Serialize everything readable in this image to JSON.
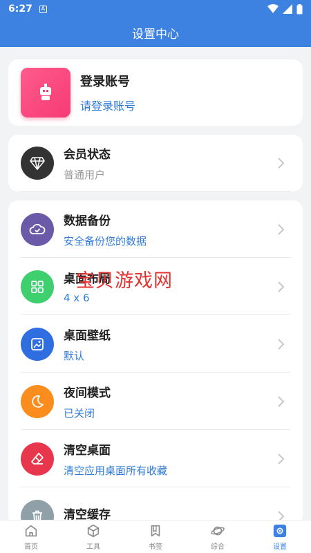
{
  "status_bar": {
    "time": "6:27",
    "notif_glyph": "A"
  },
  "header": {
    "title": "设置中心"
  },
  "login": {
    "title": "登录账号",
    "subtitle": "请登录账号"
  },
  "member": {
    "title": "会员状态",
    "subtitle": "普通用户"
  },
  "settings": [
    {
      "title": "数据备份",
      "subtitle": "安全备份您的数据",
      "color": "#6a5aa8",
      "icon": "cloud-icon"
    },
    {
      "title": "桌面布局",
      "subtitle": "4 x 6",
      "color": "#3ecf6f",
      "icon": "grid-icon"
    },
    {
      "title": "桌面壁纸",
      "subtitle": "默认",
      "color": "#2f6ee0",
      "icon": "image-icon"
    },
    {
      "title": "夜间模式",
      "subtitle": "已关闭",
      "color": "#fb8c1e",
      "icon": "moon-icon"
    },
    {
      "title": "清空桌面",
      "subtitle": "清空应用桌面所有收藏",
      "color": "#e8364d",
      "icon": "eraser-icon"
    },
    {
      "title": "清空缓存",
      "subtitle": "",
      "color": "#8fa0a8",
      "icon": "trash-icon"
    }
  ],
  "watermark": "宝贝游戏网",
  "tabs": [
    {
      "label": "首页",
      "icon": "home-icon"
    },
    {
      "label": "工具",
      "icon": "box-icon"
    },
    {
      "label": "书签",
      "icon": "bookmark-icon"
    },
    {
      "label": "综合",
      "icon": "planet-icon"
    },
    {
      "label": "设置",
      "icon": "settings-icon",
      "active": true
    }
  ],
  "colors": {
    "primary": "#3d82e0",
    "link": "#2f7bd9",
    "login_avatar": "#f53b73",
    "member_icon": "#333333"
  }
}
